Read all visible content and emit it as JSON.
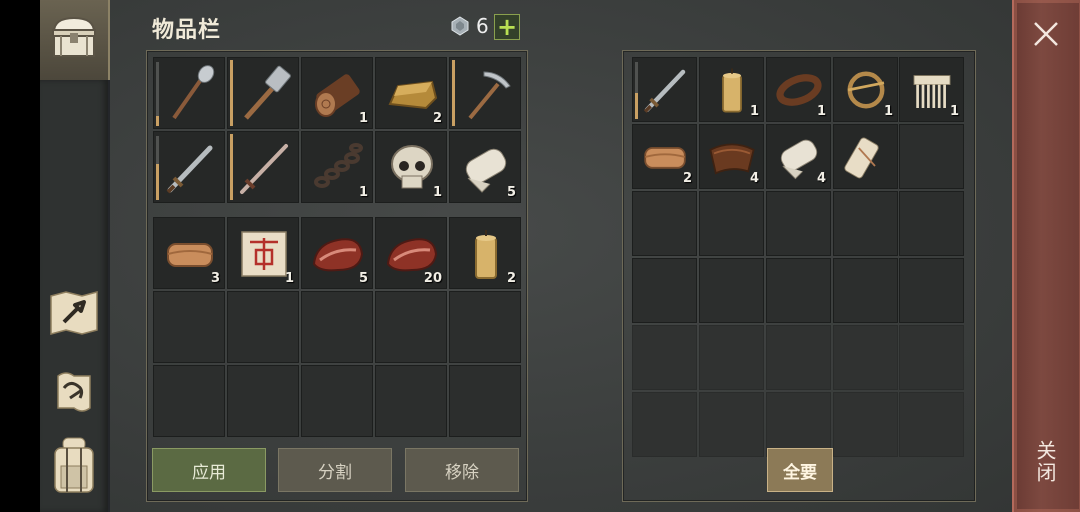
{
  "header": {
    "title": "物品栏",
    "gem_count": "6",
    "plus": "+"
  },
  "side_tabs": [
    "chest-icon",
    "crafting-map-icon",
    "quest-scroll-icon",
    "backpack-icon"
  ],
  "inventory": {
    "tools": [
      {
        "icon": "shovel-icon",
        "durability": 0.15
      },
      {
        "icon": "hammer-icon",
        "durability": 1.0
      },
      {
        "icon": "log-icon",
        "count": "1"
      },
      {
        "icon": "ingot-icon",
        "count": "2"
      },
      {
        "icon": "pickaxe-icon",
        "durability": 1.0
      },
      {
        "icon": "sword-icon",
        "durability": 0.55
      },
      {
        "icon": "longsword-icon",
        "durability": 1.0
      },
      {
        "icon": "chain-icon",
        "count": "1"
      },
      {
        "icon": "skull-icon",
        "count": "1"
      },
      {
        "icon": "cloth-roll-icon",
        "count": "5"
      }
    ],
    "items": [
      {
        "icon": "leather-icon",
        "count": "3"
      },
      {
        "icon": "recipe-scroll-icon",
        "count": "1"
      },
      {
        "icon": "raw-meat-icon",
        "count": "5"
      },
      {
        "icon": "raw-meat-icon",
        "count": "20"
      },
      {
        "icon": "candle-icon",
        "count": "2"
      }
    ]
  },
  "container": [
    {
      "icon": "sword-icon",
      "durability": 0.4
    },
    {
      "icon": "candle-icon",
      "count": "1"
    },
    {
      "icon": "leather-strap-icon",
      "count": "1"
    },
    {
      "icon": "brooch-icon",
      "count": "1"
    },
    {
      "icon": "comb-icon",
      "count": "1"
    },
    {
      "icon": "leather-icon",
      "count": "2"
    },
    {
      "icon": "hide-icon",
      "count": "4"
    },
    {
      "icon": "cloth-roll-icon",
      "count": "4"
    },
    {
      "icon": "paper-scroll-icon",
      "count": ""
    }
  ],
  "buttons": {
    "apply": "应用",
    "split": "分割",
    "remove": "移除",
    "take_all": "全要"
  },
  "close": {
    "label": "关闭"
  },
  "colors": {
    "apply_green": "#5b6a43",
    "plus_green": "#b9e053",
    "close_red": "#7d4940",
    "durability": "#c9a063"
  }
}
